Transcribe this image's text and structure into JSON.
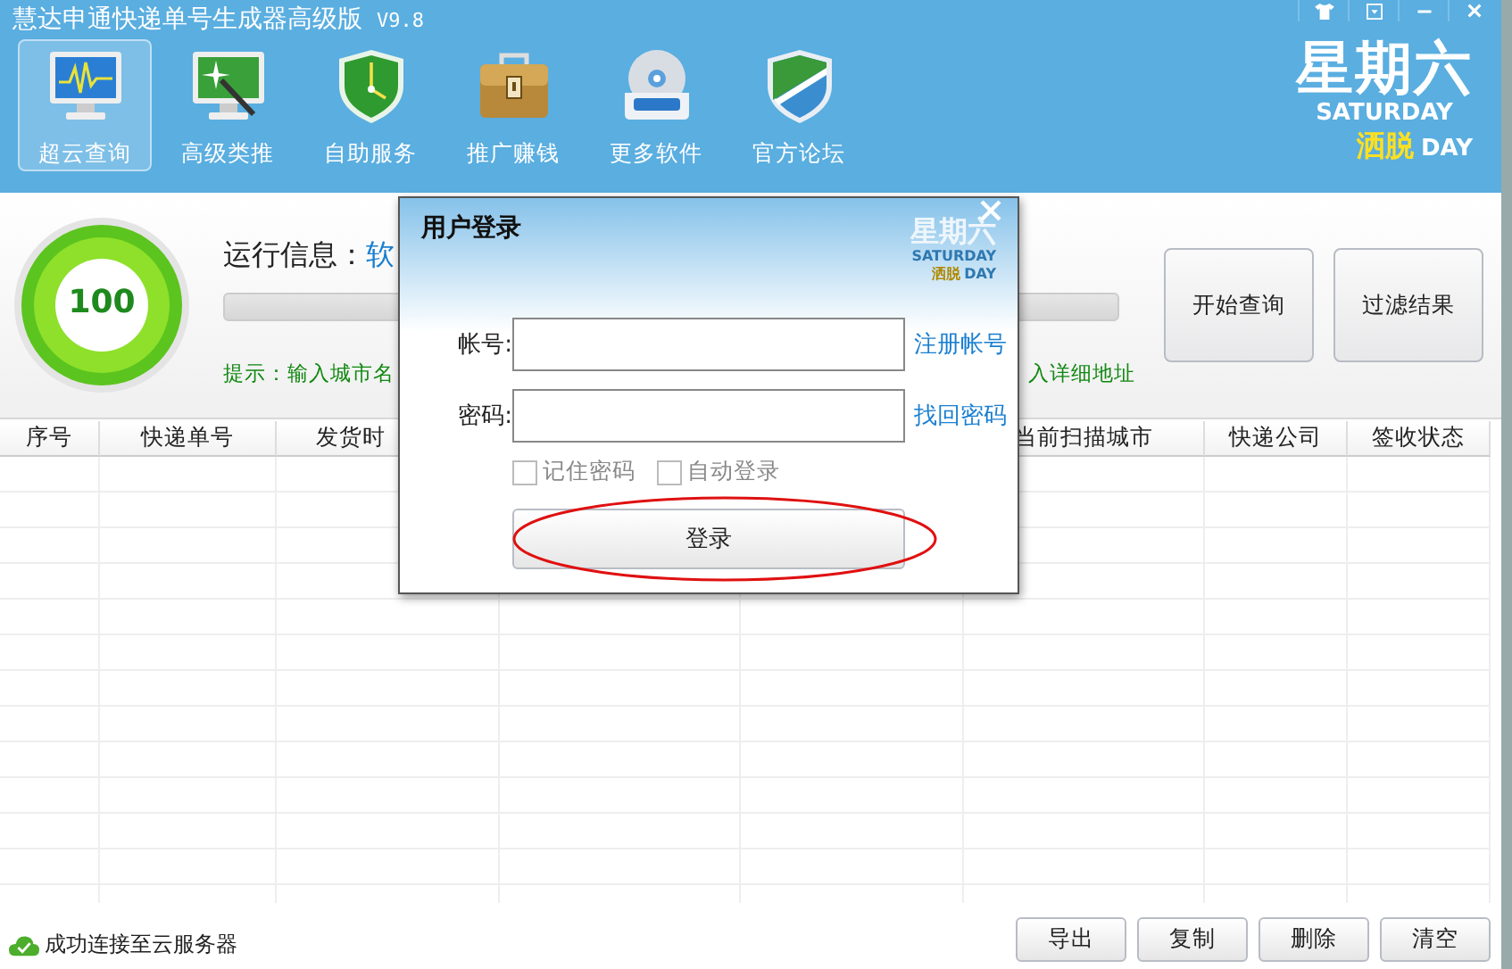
{
  "window": {
    "title": "慧达申通快递单号生成器高级版",
    "version": "V9.8"
  },
  "toolbar": [
    {
      "label": "超云查询",
      "kind": "monitor",
      "selected": true
    },
    {
      "label": "高级类推",
      "kind": "wand",
      "selected": false
    },
    {
      "label": "自助服务",
      "kind": "clock",
      "selected": false
    },
    {
      "label": "推广赚钱",
      "kind": "briefcase",
      "selected": false
    },
    {
      "label": "更多软件",
      "kind": "disc",
      "selected": false
    },
    {
      "label": "官方论坛",
      "kind": "shield",
      "selected": false
    }
  ],
  "logo": {
    "title": "星期六",
    "subtitle": "SATURDAY",
    "accent": "洒脱",
    "tail": "DAY"
  },
  "status_panel": {
    "score": "100",
    "run_info_label": "运行信息：",
    "run_info_value": "软",
    "level": 0,
    "hint_left": "提示：输入城市名",
    "hint_right": "入详细地址"
  },
  "actions": [
    "开始查询",
    "过滤结果"
  ],
  "table": {
    "columns_left": [
      "序号",
      "快递单号",
      "发货时"
    ],
    "columns_right": [
      "当前扫描城市",
      "快递公司",
      "签收状态"
    ]
  },
  "status_bar": {
    "message": "成功连接至云服务器",
    "buttons": [
      "导出",
      "复制",
      "删除",
      "清空"
    ]
  },
  "dialog": {
    "title": "用户登录",
    "watermark": {
      "title": "星期六",
      "subtitle": "SATURDAY",
      "accent": "洒脱",
      "tail": "DAY"
    },
    "fields": [
      {
        "label": "帐号:",
        "link": "注册帐号"
      },
      {
        "label": "密码:",
        "link": "找回密码"
      }
    ],
    "options": [
      {
        "label": "记住密码",
        "checked": false,
        "disabled": true
      },
      {
        "label": "自动登录",
        "checked": false,
        "disabled": true
      }
    ],
    "submit": "登录",
    "submit_circled": true
  }
}
